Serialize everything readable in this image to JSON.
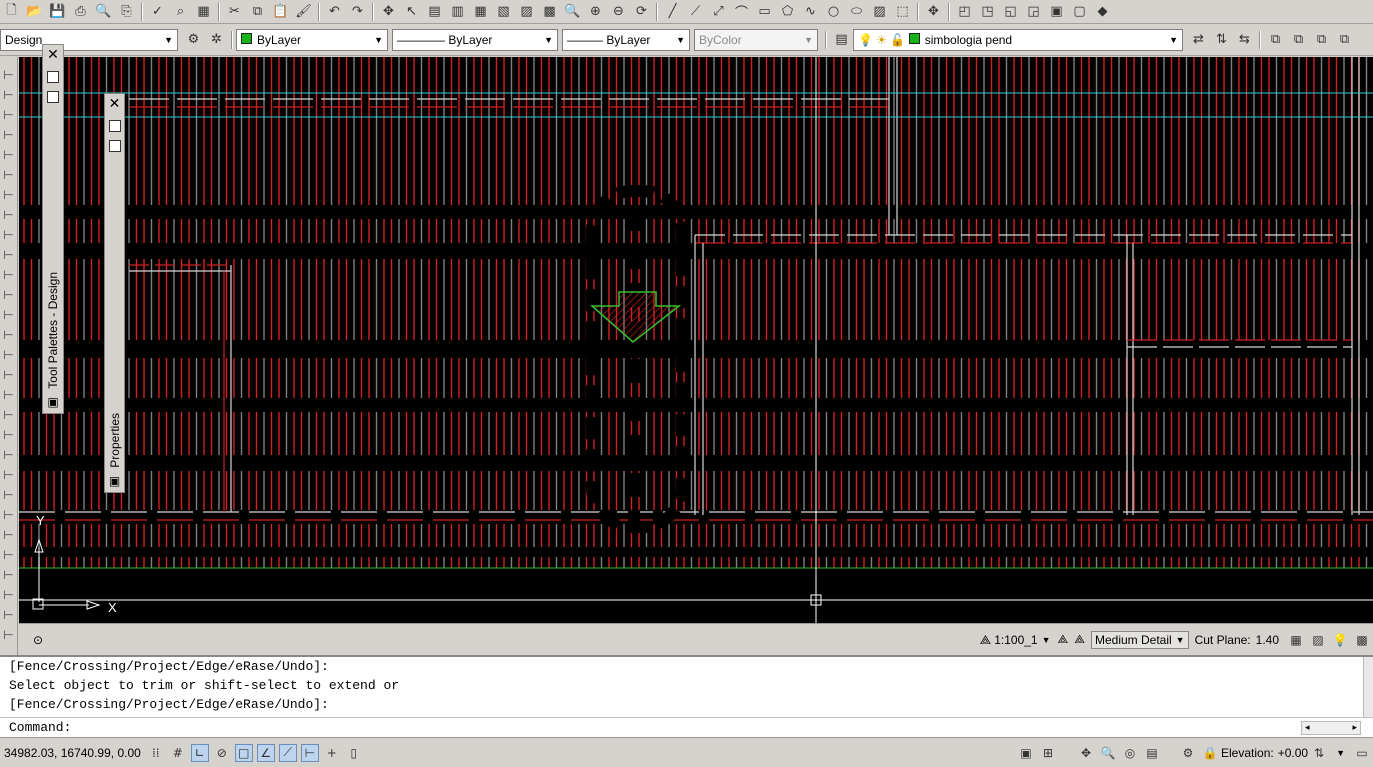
{
  "toolbar_top": {
    "icons": [
      "new-icon",
      "open-icon",
      "save-icon",
      "print-icon",
      "plot-preview-icon",
      "publish-icon",
      "spellcheck-icon",
      "find-replace-icon",
      "calculator-icon",
      "cut-icon",
      "copy-icon",
      "paste-icon",
      "match-properties-icon",
      "undo-icon",
      "redo-icon",
      "pan-icon",
      "select-icon",
      "properties-icon",
      "design-center-icon",
      "tool-palette-icon",
      "sheet-set-icon",
      "markup-icon",
      "quickcalc-icon",
      "zoom-realtime-icon",
      "zoom-window-icon",
      "zoom-previous-icon",
      "orbit-icon",
      "line-icon",
      "polyline-icon",
      "construction-line-icon",
      "arc-icon",
      "rectangle-icon",
      "polygon-icon",
      "spline-icon",
      "circle-icon",
      "ellipse-icon",
      "hatch-icon",
      "region-icon",
      "move-icon",
      "view-front-icon",
      "view-back-icon",
      "view-left-icon",
      "view-right-icon",
      "view-top-icon",
      "view-bottom-icon",
      "visual-style-icon"
    ]
  },
  "toolbar_props": {
    "workspace": "Design",
    "color_value": "ByLayer",
    "color_swatch": "#16b216",
    "linetype_value": "ByLayer",
    "lineweight_value": "ByLayer",
    "plotstyle_value": "ByColor",
    "layer_value": "simbologia pend",
    "layer_swatch": "#16b216"
  },
  "palettes": {
    "tool_palette_title": "Tool Palettes - Design",
    "properties_title": "Properties"
  },
  "drawing_status": {
    "scale": "1:100_1",
    "detail": "Medium Detail",
    "cut_plane_label": "Cut Plane:",
    "cut_plane_value": "1.40"
  },
  "command_line": {
    "history": [
      "[Fence/Crossing/Project/Edge/eRase/Undo]:",
      "Select object to trim or shift-select to extend or",
      "[Fence/Crossing/Project/Edge/eRase/Undo]:"
    ],
    "prompt": "Command:"
  },
  "status_bar": {
    "coordinates": "34982.03, 16740.99, 0.00",
    "elevation_label": "Elevation:",
    "elevation_value": "+0.00"
  },
  "ucs": {
    "x_label": "X",
    "y_label": "Y"
  },
  "colors": {
    "canvas_bg": "#000000",
    "hatch_red": "#d42020",
    "wall_white": "#e8e8e8",
    "cyan_line": "#2fd0d8",
    "green_line": "#20c030",
    "arrow_green": "#30c030"
  }
}
